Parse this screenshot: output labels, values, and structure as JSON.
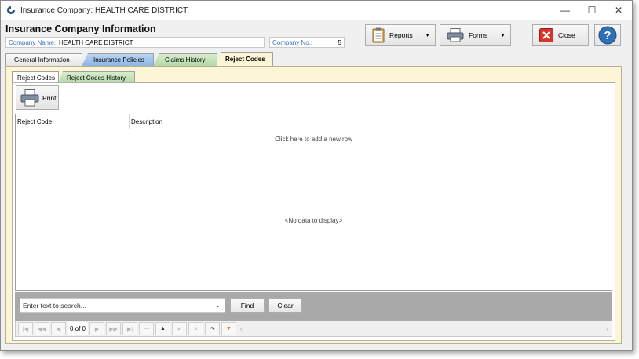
{
  "window": {
    "title": "Insurance Company:  HEALTH CARE DISTRICT",
    "minimize": "—",
    "maximize": "☐",
    "close": "✕"
  },
  "header": {
    "title": "Insurance Company Information",
    "company_name_label": "Company Name:",
    "company_name_value": "HEALTH CARE DISTRICT",
    "company_no_label": "Company No.:",
    "company_no_value": "5"
  },
  "toolbar": {
    "reports_label": "Reports",
    "forms_label": "Forms",
    "close_label": "Close",
    "help_label": "?"
  },
  "tabs": [
    {
      "label": "General Information"
    },
    {
      "label": "Insurance Policies"
    },
    {
      "label": "Claims History"
    },
    {
      "label": "Reject Codes"
    }
  ],
  "subtabs": [
    {
      "label": "Reject Codes"
    },
    {
      "label": "Reject Codes History"
    }
  ],
  "print_label": "Print",
  "grid": {
    "columns": [
      "Reject Code",
      "Description"
    ],
    "add_row_text": "Click here to add a new row",
    "no_data_text": "<No data to display>"
  },
  "search": {
    "placeholder": "Enter text to search...",
    "find_label": "Find",
    "clear_label": "Clear"
  },
  "navigator": {
    "page_indicator": "0 of 0"
  },
  "colors": {
    "active_tab_bg": "#fcf6d7",
    "insurance_tab_bg": "#8db6e6",
    "claims_tab_bg": "#b6d9a8",
    "field_label": "#3b73c5",
    "close_icon_red": "#d9342b",
    "help_blue": "#2f6fb5"
  }
}
